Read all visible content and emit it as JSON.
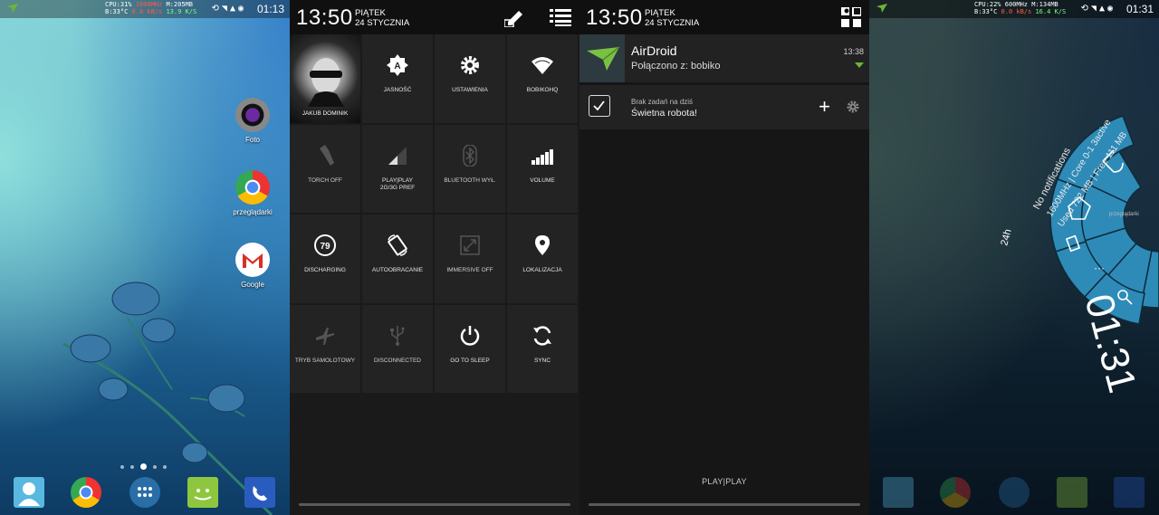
{
  "status_bar": {
    "panel1": {
      "cpu": "CPU:31%",
      "freq": "1600MHz",
      "mem": "M:205MB",
      "temp": "B:33°C",
      "net_down": "0.0 kB/s",
      "net_up": "0.0 kB/s",
      "net_total": "13.9 K/S",
      "clock": "01:13"
    },
    "panel4": {
      "cpu": "CPU:22%",
      "freq": "600MHz",
      "mem": "M:134MB",
      "temp": "B:33°C",
      "net_down": "0.0 kB/s",
      "net_up": "0.0 kB/s",
      "net_total": "16.4 K/S",
      "clock": "01:31"
    }
  },
  "home": {
    "icons": [
      {
        "label": "Foto",
        "icon": "camera-icon"
      },
      {
        "label": "przeglądarki",
        "icon": "chrome-icon"
      },
      {
        "label": "Google",
        "icon": "gmail-icon"
      }
    ],
    "dock": [
      "contacts-icon",
      "chrome-icon",
      "app-drawer-icon",
      "android-icon",
      "phone-icon"
    ]
  },
  "quick_settings": {
    "time": "13:50",
    "day": "PIĄTEK",
    "date": "24 STYCZNIA",
    "tiles": [
      {
        "label": "JAKUB DOMINIK",
        "icon": "user-photo"
      },
      {
        "label": "JASNOŚĆ",
        "icon": "brightness-icon"
      },
      {
        "label": "USTAWIENIA",
        "icon": "settings-icon"
      },
      {
        "label": "BOBIKOHQ",
        "icon": "wifi-icon"
      },
      {
        "label": "TORCH OFF",
        "icon": "flashlight-icon"
      },
      {
        "label": "PLAY|PLAY\n2G/3G PREF",
        "icon": "signal-icon"
      },
      {
        "label": "BLUETOOTH WYŁ.",
        "icon": "bluetooth-icon"
      },
      {
        "label": "VOLUME",
        "icon": "volume-icon"
      },
      {
        "label": "DISCHARGING",
        "icon": "battery-icon",
        "value": "79"
      },
      {
        "label": "AUTOOBRACANIE",
        "icon": "rotate-icon"
      },
      {
        "label": "IMMERSIVE OFF",
        "icon": "immersive-icon"
      },
      {
        "label": "LOKALIZACJA",
        "icon": "location-icon"
      },
      {
        "label": "TRYB SAMOLOTOWY",
        "icon": "airplane-icon"
      },
      {
        "label": "DISCONNECTED",
        "icon": "usb-icon"
      },
      {
        "label": "GO TO SLEEP",
        "icon": "power-icon"
      },
      {
        "label": "SYNC",
        "icon": "sync-icon"
      }
    ]
  },
  "notifications": {
    "time": "13:50",
    "day": "PIĄTEK",
    "date": "24 STYCZNIA",
    "items": [
      {
        "app": "AirDroid",
        "text": "Połączono z: bobiko",
        "time": "13:38"
      },
      {
        "small": "Brak zadań na dziś",
        "big": "Świetna robota!"
      }
    ],
    "carrier": "PLAY|PLAY"
  },
  "pie": {
    "clock": "01:31",
    "format": "24h",
    "info_line1": "No notifications",
    "info_line2": "1600MHz | Core 0-1 3active",
    "info_line3": "Used 722 MB | Free 111 MB",
    "side_label": "przeglądarki"
  }
}
